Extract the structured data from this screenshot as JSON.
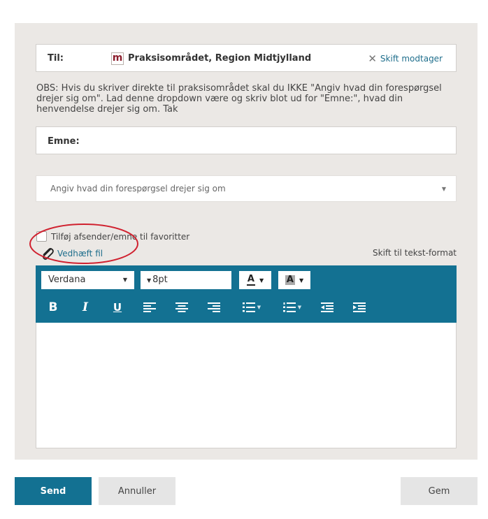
{
  "recipient": {
    "label": "Til:",
    "logo_letter": "m",
    "name": "Praksisområdet, Region Midtjylland",
    "change_label": "Skift modtager"
  },
  "note": "OBS: Hvis du skriver direkte til praksisområdet skal du IKKE \"Angiv hvad din forespørgsel drejer sig om\". Lad denne dropdown være og skriv blot ud for \"Emne:\", hvad din henvendelse drejer sig om. Tak",
  "subject": {
    "label": "Emne:",
    "value": ""
  },
  "topic_select": {
    "placeholder": "Angiv hvad din forespørgsel drejer sig om"
  },
  "favorites_checkbox": {
    "label": "Tilføj afsender/emne til favoritter",
    "checked": false
  },
  "attach": {
    "label": "Vedhæft fil"
  },
  "text_format_link": "Skift til tekst-format",
  "toolbar": {
    "font": "Verdana",
    "size": "8pt",
    "fg_letter": "A",
    "bg_letter": "A",
    "bold": "B",
    "italic": "I",
    "underline": "U"
  },
  "actions": {
    "send": "Send",
    "cancel": "Annuller",
    "save": "Gem"
  },
  "colors": {
    "accent": "#137192",
    "panel": "#ebe8e5",
    "link": "#1f6e8c",
    "highlight_ellipse": "#d0212f",
    "logo": "#8b1d2c"
  }
}
